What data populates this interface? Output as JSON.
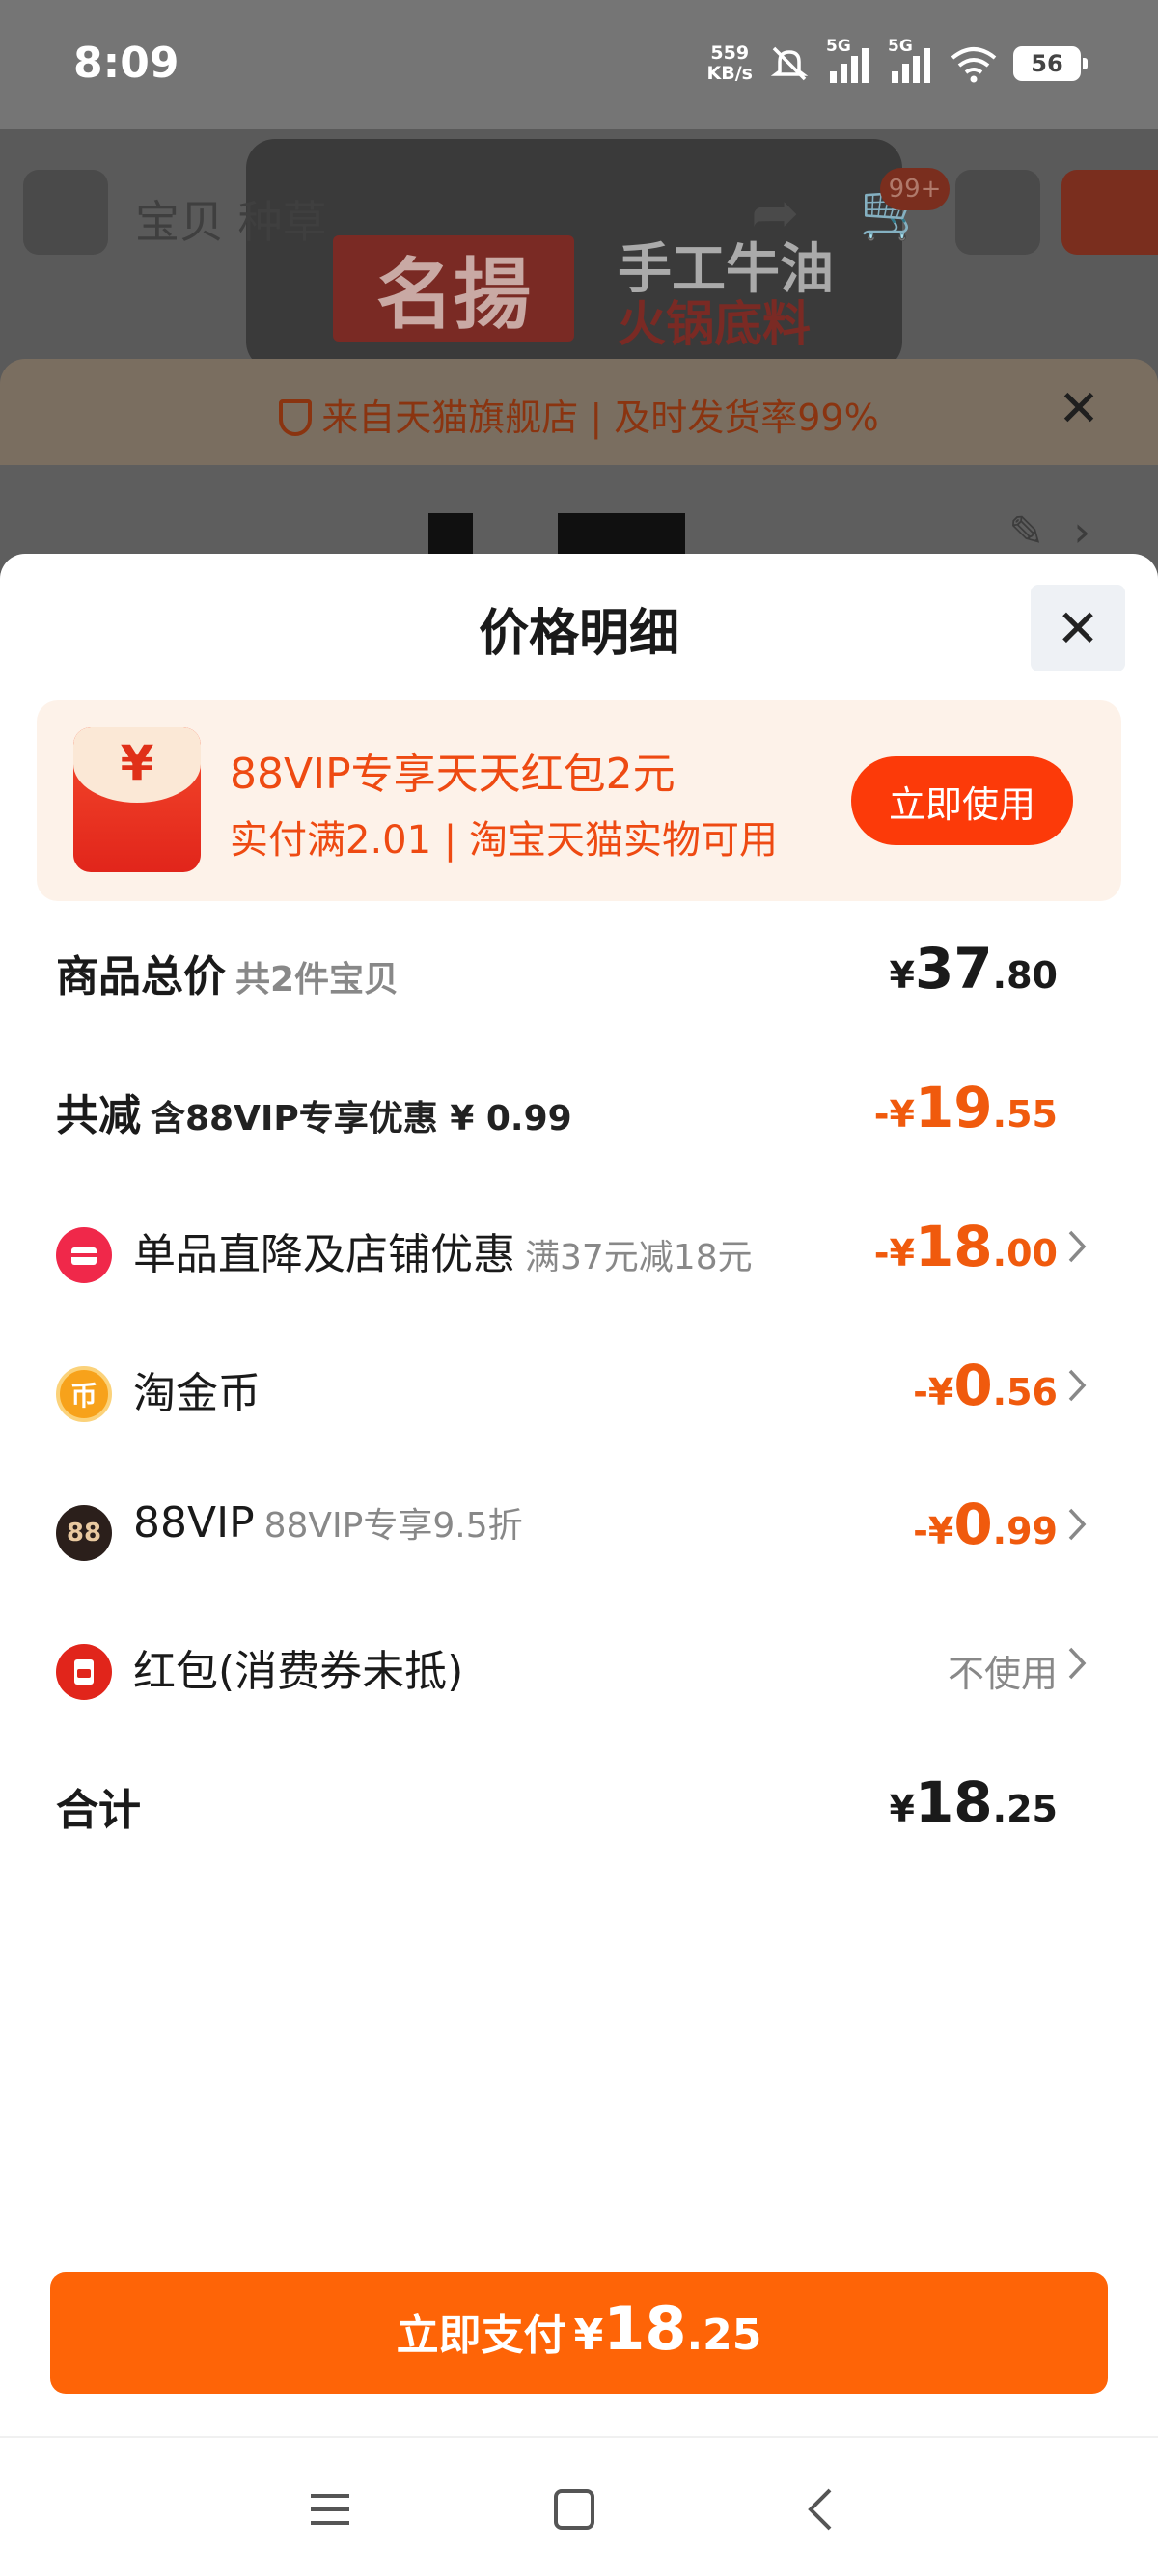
{
  "status_bar": {
    "time": "8:09",
    "net_speed_value": "559",
    "net_speed_unit": "KB/s",
    "signal1_tag": "5G",
    "signal2_tag": "5G",
    "battery": "56"
  },
  "background_page": {
    "tab_label": "宝贝 种草",
    "cart_badge": "99+",
    "brand_name": "名揚",
    "slogan_line1": "手工牛油",
    "slogan_line2": "火锅底料",
    "store_banner_text": "来自天猫旗舰店 | 及时发货率99%"
  },
  "sheet": {
    "title": "价格明细",
    "close_icon": "close-icon"
  },
  "promo": {
    "title": "88VIP专享天天红包2元",
    "subtitle": "实付满2.01 | 淘宝天猫实物可用",
    "button": "立即使用",
    "envelope_symbol": "¥"
  },
  "rows": [
    {
      "label": "商品总价",
      "sub": "共2件宝贝",
      "currency": "¥",
      "int": "37",
      "dec": ".80"
    },
    {
      "label": "共减",
      "sub": "含88VIP专享优惠 ¥ 0.99",
      "currency": "-¥",
      "int": "19",
      "dec": ".55"
    },
    {
      "label": "单品直降及店铺优惠",
      "sub": "满37元减18元",
      "currency": "-¥",
      "int": "18",
      "dec": ".00",
      "icon_text": ""
    },
    {
      "label": "淘金币",
      "sub": "",
      "currency": "-¥",
      "int": "0",
      "dec": ".56",
      "icon_text": "币"
    },
    {
      "label": "88VIP",
      "sub": "88VIP专享9.5折",
      "currency": "-¥",
      "int": "0",
      "dec": ".99",
      "icon_text": "88"
    },
    {
      "label": "红包(消费券未抵)",
      "value": "不使用",
      "icon_text": ""
    },
    {
      "label": "合计",
      "currency": "¥",
      "int": "18",
      "dec": ".25"
    }
  ],
  "pay_button": {
    "label": "立即支付",
    "currency": "¥",
    "int": "18",
    "dec": ".25"
  },
  "colors": {
    "accent_orange": "#fe6407",
    "discount_orange": "#f05a0d",
    "promo_bg": "#fdf2e9",
    "red": "#e1251b"
  }
}
